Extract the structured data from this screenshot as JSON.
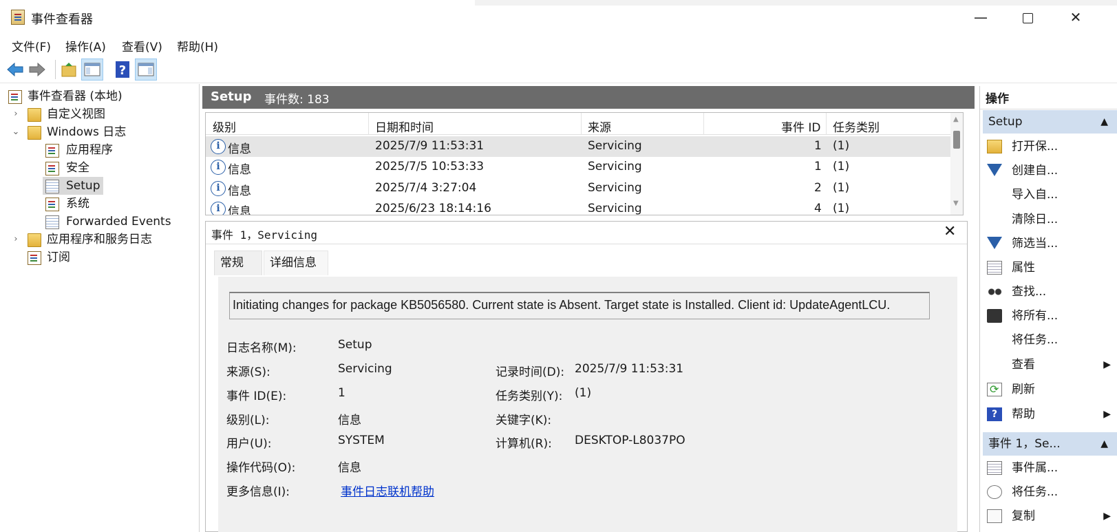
{
  "window": {
    "title": "事件查看器"
  },
  "menu": [
    "文件(F)",
    "操作(A)",
    "查看(V)",
    "帮助(H)"
  ],
  "tree": {
    "root": "事件查看器 (本地)",
    "custom_views": "自定义视图",
    "windows_logs": "Windows 日志",
    "logs": [
      "应用程序",
      "安全",
      "Setup",
      "系统",
      "Forwarded Events"
    ],
    "app_service_logs": "应用程序和服务日志",
    "subscriptions": "订阅"
  },
  "center": {
    "log_name": "Setup",
    "event_count": "事件数: 183",
    "columns": [
      "级别",
      "日期和时间",
      "来源",
      "事件 ID",
      "任务类别"
    ],
    "rows": [
      {
        "level": "信息",
        "datetime": "2025/7/9 11:53:31",
        "source": "Servicing",
        "id": "1",
        "task": "(1)"
      },
      {
        "level": "信息",
        "datetime": "2025/7/5 10:53:33",
        "source": "Servicing",
        "id": "1",
        "task": "(1)"
      },
      {
        "level": "信息",
        "datetime": "2025/7/4 3:27:04",
        "source": "Servicing",
        "id": "2",
        "task": "(1)"
      },
      {
        "level": "信息",
        "datetime": "2025/6/23 18:14:16",
        "source": "Servicing",
        "id": "4",
        "task": "(1)"
      }
    ]
  },
  "detail": {
    "title": "事件 1，Servicing",
    "close_glyph": "✕",
    "tabs": [
      "常规",
      "详细信息"
    ],
    "message": "Initiating changes for package KB5056580. Current state is Absent. Target state is Installed. Client id: UpdateAgentLCU.",
    "fields": {
      "log_name_label": "日志名称(M):",
      "log_name": "Setup",
      "source_label": "来源(S):",
      "source": "Servicing",
      "logged_label": "记录时间(D):",
      "logged": "2025/7/9 11:53:31",
      "event_id_label": "事件 ID(E):",
      "event_id": "1",
      "task_label": "任务类别(Y):",
      "task": "(1)",
      "level_label": "级别(L):",
      "level": "信息",
      "keywords_label": "关键字(K):",
      "user_label": "用户(U):",
      "user": "SYSTEM",
      "computer_label": "计算机(R):",
      "computer": "DESKTOP-L8037PO",
      "opcode_label": "操作代码(O):",
      "opcode": "信息",
      "more_info_label": "更多信息(I):",
      "more_info_link": "事件日志联机帮助"
    }
  },
  "actions": {
    "header": "操作",
    "section1": "Setup",
    "items1": [
      {
        "label": "打开保...",
        "icon": "folder-open-icon"
      },
      {
        "label": "创建自...",
        "icon": "filter-icon"
      },
      {
        "label": "导入自...",
        "icon": ""
      },
      {
        "label": "清除日...",
        "icon": ""
      },
      {
        "label": "筛选当...",
        "icon": "filter-icon"
      },
      {
        "label": "属性",
        "icon": "properties-icon"
      },
      {
        "label": "查找...",
        "icon": "find-icon"
      },
      {
        "label": "将所有...",
        "icon": "save-icon"
      },
      {
        "label": "将任务...",
        "icon": ""
      },
      {
        "label": "查看",
        "icon": ""
      },
      {
        "label": "刷新",
        "icon": "refresh-icon"
      },
      {
        "label": "帮助",
        "icon": "help-icon"
      }
    ],
    "section2": "事件 1，Se...",
    "items2": [
      {
        "label": "事件属...",
        "icon": "properties-icon"
      },
      {
        "label": "将任务...",
        "icon": "task-icon"
      },
      {
        "label": "复制",
        "icon": "copy-icon"
      }
    ]
  }
}
